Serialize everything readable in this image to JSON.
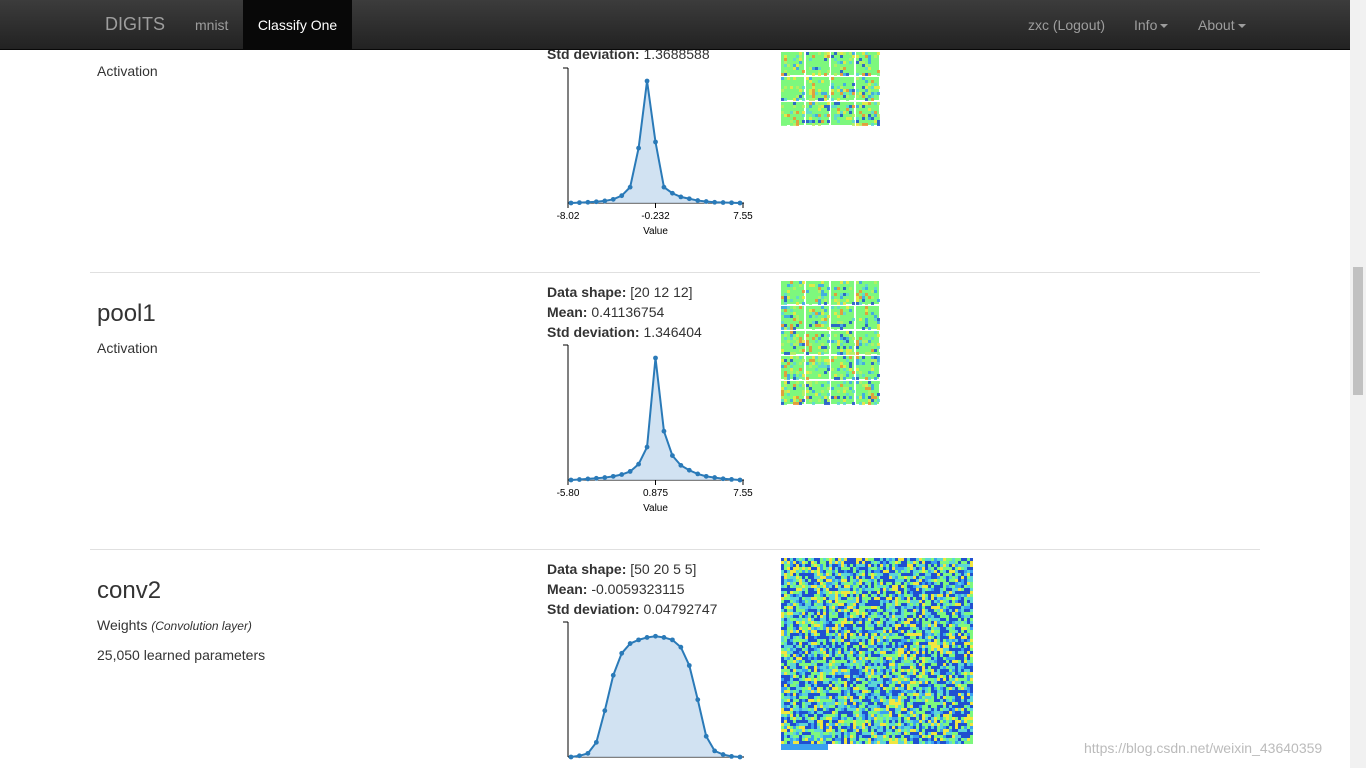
{
  "navbar": {
    "brand": "DIGITS",
    "items": [
      "mnist",
      "Classify One"
    ],
    "user": "zxc (Logout)",
    "info": "Info",
    "about": "About"
  },
  "layers": [
    {
      "name": "",
      "kind": "Activation",
      "kind_note": "",
      "params": "",
      "data_shape": "",
      "mean": "",
      "std": "1.3688588",
      "tile_rows": 3,
      "tile_cols": 4,
      "chart": {
        "xmin": "-8.02",
        "xmid": "-0.232",
        "xmax": "7.55",
        "xlabel": "Value"
      }
    },
    {
      "name": "pool1",
      "kind": "Activation",
      "kind_note": "",
      "params": "",
      "data_shape": "[20 12 12]",
      "mean": "0.41136754",
      "std": "1.346404",
      "tile_rows": 5,
      "tile_cols": 4,
      "chart": {
        "xmin": "-5.80",
        "xmid": "0.875",
        "xmax": "7.55",
        "xlabel": "Value"
      }
    },
    {
      "name": "conv2",
      "kind": "Weights",
      "kind_note": "(Convolution layer)",
      "params": "25,050 learned parameters",
      "data_shape": "[50 20 5 5]",
      "mean": "-0.0059323115",
      "std": "0.04792747",
      "tile_rows": 1,
      "tile_cols": 1,
      "chart": {
        "xmin": "",
        "xmid": "",
        "xmax": "",
        "xlabel": ""
      }
    }
  ],
  "labels": {
    "data_shape": "Data shape:",
    "mean": "Mean:",
    "std": "Std deviation:"
  },
  "chart_data": [
    {
      "type": "area",
      "xlabel": "Value",
      "xlim": [
        -8.02,
        7.55
      ],
      "x": [
        -8.02,
        -7.24,
        -6.46,
        -5.68,
        -4.9,
        -4.13,
        -3.35,
        -2.57,
        -1.79,
        -1.01,
        -0.232,
        0.55,
        1.33,
        2.1,
        2.88,
        3.66,
        4.44,
        5.22,
        6.0,
        6.77,
        7.55
      ],
      "values": [
        0,
        0.003,
        0.006,
        0.01,
        0.017,
        0.03,
        0.06,
        0.13,
        0.45,
        1.0,
        0.5,
        0.13,
        0.08,
        0.05,
        0.035,
        0.02,
        0.012,
        0.006,
        0.004,
        0.002,
        0
      ]
    },
    {
      "type": "area",
      "xlabel": "Value",
      "xlim": [
        -5.8,
        7.55
      ],
      "x": [
        -5.8,
        -5.13,
        -4.46,
        -3.8,
        -3.13,
        -2.46,
        -1.79,
        -1.12,
        -0.46,
        0.21,
        0.875,
        1.54,
        2.21,
        2.88,
        3.55,
        4.21,
        4.88,
        5.55,
        6.22,
        6.88,
        7.55
      ],
      "values": [
        0,
        0.004,
        0.009,
        0.014,
        0.02,
        0.03,
        0.045,
        0.07,
        0.13,
        0.27,
        1.0,
        0.4,
        0.2,
        0.12,
        0.08,
        0.05,
        0.03,
        0.02,
        0.01,
        0.005,
        0
      ]
    },
    {
      "type": "area",
      "xlabel": "",
      "x": [
        0,
        1,
        2,
        3,
        4,
        5,
        6,
        7,
        8,
        9,
        10,
        11,
        12,
        13,
        14,
        15,
        16,
        17,
        18,
        19,
        20
      ],
      "values": [
        0,
        0.01,
        0.03,
        0.12,
        0.38,
        0.67,
        0.85,
        0.93,
        0.96,
        0.98,
        0.99,
        0.98,
        0.96,
        0.9,
        0.75,
        0.47,
        0.17,
        0.05,
        0.02,
        0.005,
        0
      ]
    }
  ],
  "watermark": "https://blog.csdn.net/weixin_43640359"
}
